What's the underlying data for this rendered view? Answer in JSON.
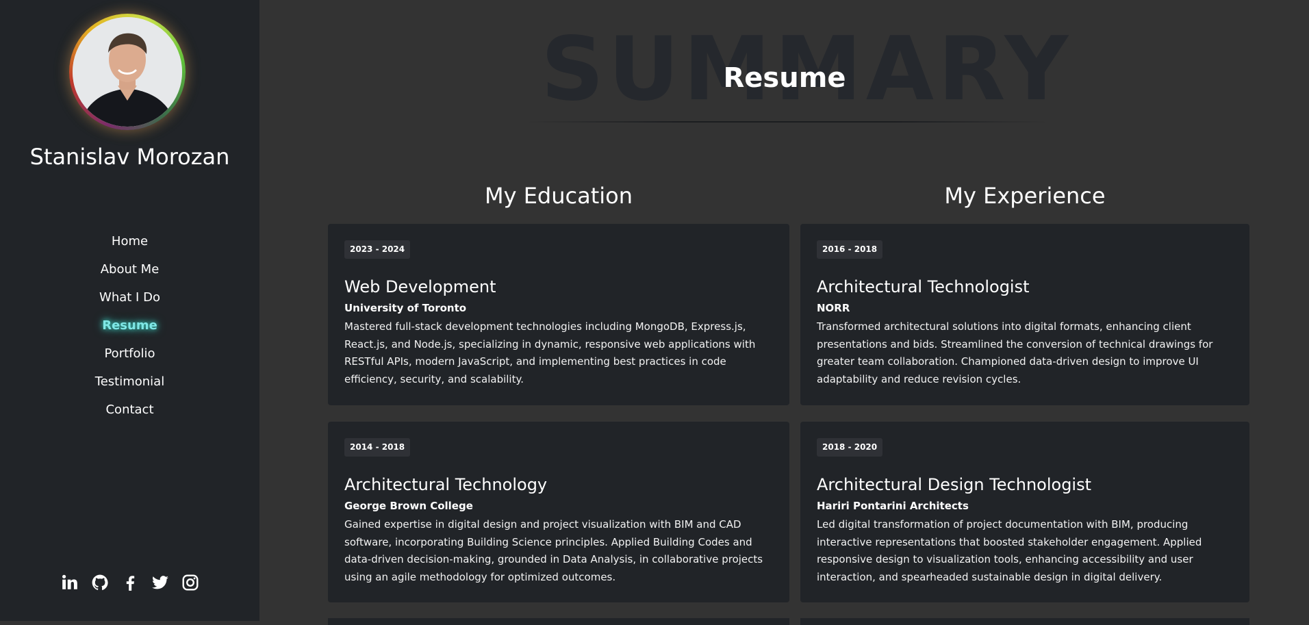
{
  "profile": {
    "name": "Stanislav Morozan"
  },
  "nav": [
    {
      "label": "Home",
      "active": false
    },
    {
      "label": "About Me",
      "active": false
    },
    {
      "label": "What I Do",
      "active": false
    },
    {
      "label": "Resume",
      "active": true
    },
    {
      "label": "Portfolio",
      "active": false
    },
    {
      "label": "Testimonial",
      "active": false
    },
    {
      "label": "Contact",
      "active": false
    }
  ],
  "social": [
    "linkedin-icon",
    "github-icon",
    "facebook-icon",
    "twitter-icon",
    "instagram-icon"
  ],
  "section": {
    "background_word": "SUMMARY",
    "title": "Resume"
  },
  "education": {
    "heading": "My Education",
    "items": [
      {
        "years": "2023 - 2024",
        "title": "Web Development",
        "org": "University of Toronto",
        "description": "Mastered full-stack development technologies including MongoDB, Express.js, React.js, and Node.js, specializing in dynamic, responsive web applications with RESTful APIs, modern JavaScript, and implementing best practices in code efficiency, security, and scalability."
      },
      {
        "years": "2014 - 2018",
        "title": "Architectural Technology",
        "org": "George Brown College",
        "description": "Gained expertise in digital design and project visualization with BIM and CAD software, incorporating Building Science principles. Applied Building Codes and data-driven decision-making, grounded in Data Analysis, in collaborative projects using an agile methodology for optimized outcomes."
      }
    ]
  },
  "experience": {
    "heading": "My Experience",
    "items": [
      {
        "years": "2016 - 2018",
        "title": "Architectural Technologist",
        "org": "NORR",
        "description": "Transformed architectural solutions into digital formats, enhancing client presentations and bids. Streamlined the conversion of technical drawings for greater team collaboration. Championed data-driven design to improve UI adaptability and reduce revision cycles."
      },
      {
        "years": "2018 - 2020",
        "title": "Architectural Design Technologist",
        "org": "Hariri Pontarini Architects",
        "description": "Led digital transformation of project documentation with BIM, producing interactive representations that boosted stakeholder engagement. Applied responsive design to visualization tools, enhancing accessibility and user interaction, and spearheaded sustainable design in digital delivery."
      }
    ]
  },
  "colors": {
    "sidebar": "#212428",
    "background": "#333333",
    "card": "#212428",
    "accent": "#7fe7e6"
  }
}
